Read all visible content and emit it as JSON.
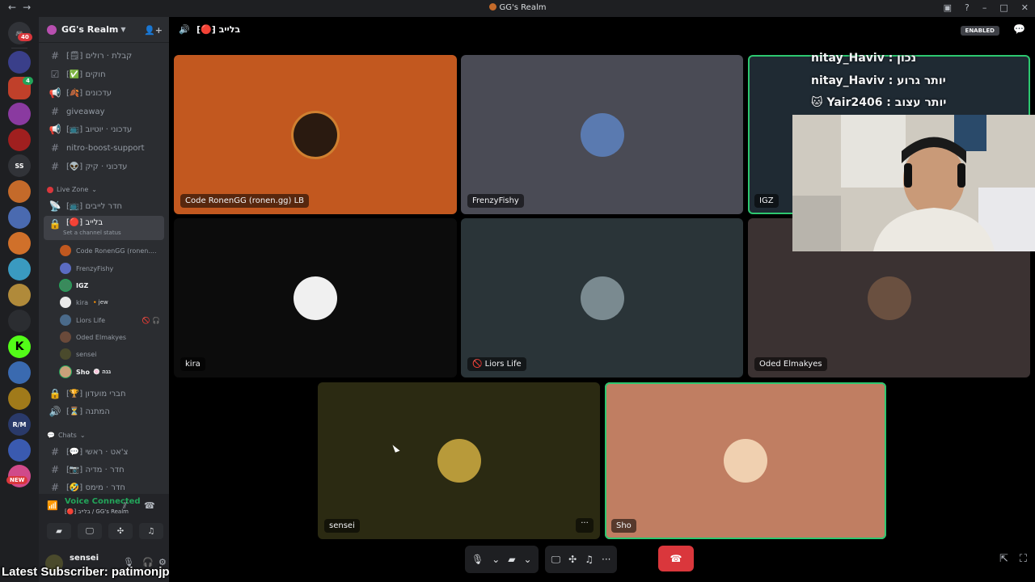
{
  "window": {
    "title": "GG's Realm",
    "nav_back": "←",
    "nav_forward": "→"
  },
  "server_rail": {
    "dm_badge": "40",
    "server_badge": "4",
    "ss_label": "SS",
    "new_badge": "NEW"
  },
  "guild": {
    "name": "GG's Realm"
  },
  "channels": [
    {
      "icon": "#",
      "label": "⁅🗒⁆ קבלת · רולים"
    },
    {
      "icon": "☑",
      "label": "⁅✅⁆ חוקים"
    },
    {
      "icon": "📢",
      "label": "⁅🍂⁆ עדכונים"
    },
    {
      "icon": "#",
      "label": "giveaway"
    },
    {
      "icon": "📢",
      "label": "⁅📺⁆ עדכוני · יוטיוב"
    },
    {
      "icon": "#",
      "label": "nitro-boost-support"
    },
    {
      "icon": "#",
      "label": "⁅👽⁆ עדכוני · קיק"
    }
  ],
  "category_live": "Live Zone",
  "live_channels": [
    {
      "icon": "📡",
      "label": "⁅📺⁆ חדר לייבים"
    }
  ],
  "active_channel": {
    "label": "⁅🔴⁆ בלייב",
    "status": "Set a channel status"
  },
  "voice_users": [
    {
      "name": "Code RonenGG (ronen....",
      "color": "#c0581f",
      "tag": "",
      "icons": "",
      "bold": false
    },
    {
      "name": "FrenzyFishy",
      "color": "#5b6cc2",
      "tag": "",
      "icons": "",
      "bold": false
    },
    {
      "name": "IGZ",
      "color": "#3a8a5c",
      "tag": "",
      "icons": "",
      "bold": true
    },
    {
      "name": "kira",
      "color": "#e9e9e9",
      "tag": "🔸jew",
      "icons": "",
      "bold": false
    },
    {
      "name": "Liors Life",
      "color": "#4a6a8a",
      "tag": "",
      "icons": "🚫 🎧",
      "bold": false
    },
    {
      "name": "Oded Elmakyes",
      "color": "#6a4a3a",
      "tag": "",
      "icons": "",
      "bold": false
    },
    {
      "name": "sensei",
      "color": "#4a4a2c",
      "tag": "",
      "icons": "",
      "bold": false
    },
    {
      "name": "Sho",
      "color": "#c9a07a",
      "tag": "🍥 גגה",
      "icons": "",
      "bold": true
    }
  ],
  "more_channels": [
    {
      "icon": "🔒",
      "label": "⁅🏆⁆ חברי מועדון"
    },
    {
      "icon": "🔊",
      "label": "⁅⏳⁆ המתנה"
    }
  ],
  "category_chats": "Chats",
  "chat_channels": [
    {
      "icon": "#",
      "label": "⁅💬⁆ צ'אט · ראשי"
    },
    {
      "icon": "#",
      "label": "⁅📷⁆ חדר · מדיה"
    },
    {
      "icon": "#",
      "label": "⁅🤣⁆ חדר · מימס"
    }
  ],
  "voice_panel": {
    "status": "Voice Connected",
    "location": "⁅🔴⁆ בלייב / GG's Realm"
  },
  "user_panel": {
    "username": "sensei"
  },
  "header": {
    "channel_name": "⁅🔴⁆ בלייב",
    "enabled_label": "ENABLED"
  },
  "tiles": [
    {
      "name": "Code RonenGG (ronen.gg) LB",
      "bg": "#c2581f",
      "avatar": "#2a1a10"
    },
    {
      "name": "FrenzyFishy",
      "bg": "#4a4b55",
      "avatar": "#5a7ab0"
    },
    {
      "name": "IGZ",
      "bg": "#1f2a33",
      "avatar": "#3a8a5c"
    },
    {
      "name": "kira",
      "bg": "#0c0c0c",
      "avatar": "#f0f0f0"
    },
    {
      "name": "Liors Life",
      "bg": "#2a3438",
      "avatar": "#7a8a90"
    },
    {
      "name": "Oded Elmakyes",
      "bg": "#3b3232",
      "avatar": "#6a5040"
    },
    {
      "name": "sensei",
      "bg": "#2b2a12",
      "avatar": "#b89a3a"
    },
    {
      "name": "Sho",
      "bg": "#c07e62",
      "avatar": "#f0d0b0"
    }
  ],
  "tile_menu": "···",
  "overlay": [
    {
      "text": "nitay_Haviv : נכון"
    },
    {
      "text": "nitay_Haviv : יותר גרוע"
    },
    {
      "text": "Yair2406 : יותר עצוב"
    }
  ],
  "latest_subscriber": "Latest Subscriber: patimonjp"
}
